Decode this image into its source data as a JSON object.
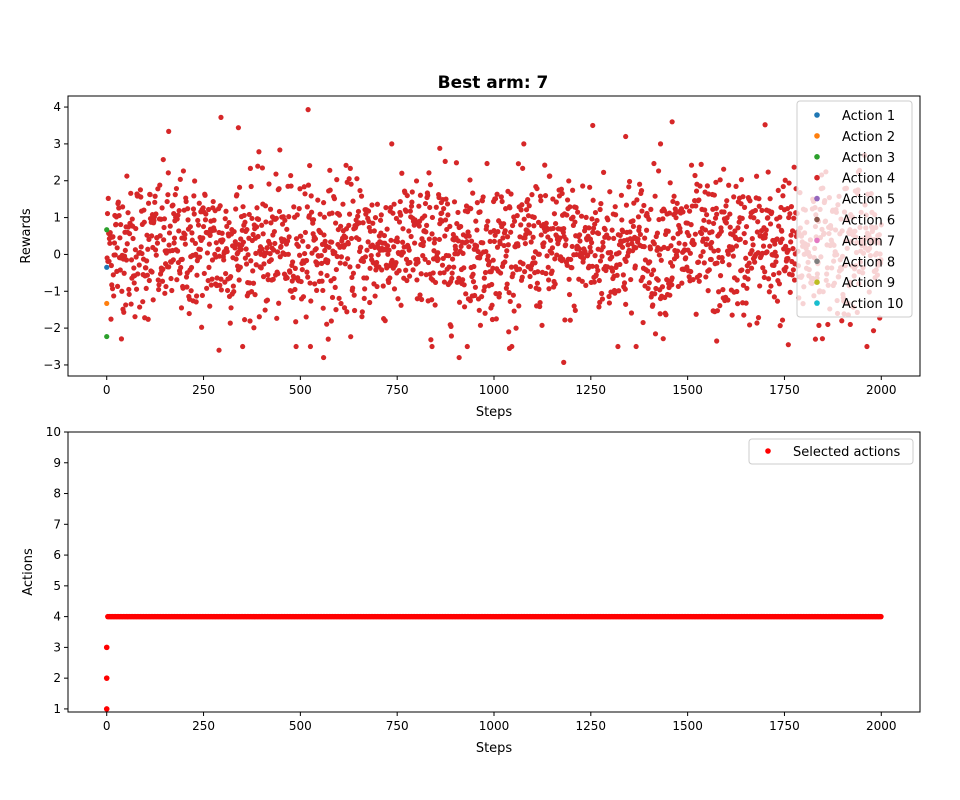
{
  "chart_data": [
    {
      "type": "scatter",
      "title": "Best arm: 7",
      "xlabel": "Steps",
      "ylabel": "Rewards",
      "xlim": [
        -100,
        2100
      ],
      "ylim": [
        -3.3,
        4.3
      ],
      "xticks": [
        0,
        250,
        500,
        750,
        1000,
        1250,
        1500,
        1750,
        2000
      ],
      "yticks": [
        -3,
        -2,
        -1,
        0,
        1,
        2,
        3,
        4
      ],
      "grid": false,
      "legend_position": "top-right",
      "n_steps": 2000,
      "series": [
        {
          "name": "Action 1",
          "color": "#1f77b4",
          "points": [
            [
              0,
              -0.35
            ]
          ]
        },
        {
          "name": "Action 2",
          "color": "#ff7f0e",
          "points": [
            [
              0,
              -1.33
            ]
          ]
        },
        {
          "name": "Action 3",
          "color": "#2ca02c",
          "points": [
            [
              0,
              0.67
            ],
            [
              0,
              -2.23
            ]
          ]
        },
        {
          "name": "Action 4",
          "color": "#d62728",
          "description": "noisy rewards every step 1..2000, mean ~0.2, std ~1.0, range about -2.9 to 3.9",
          "points": [
            [
              520,
              3.93
            ],
            [
              295,
              3.72
            ],
            [
              1460,
              3.6
            ],
            [
              1255,
              3.5
            ],
            [
              1700,
              3.52
            ],
            [
              340,
              3.44
            ],
            [
              160,
              3.34
            ],
            [
              1340,
              3.2
            ],
            [
              1430,
              3.0
            ],
            [
              860,
              2.88
            ],
            [
              1180,
              -2.93
            ],
            [
              910,
              -2.8
            ],
            [
              560,
              -2.8
            ],
            [
              290,
              -2.6
            ],
            [
              1920,
              -1.9
            ],
            [
              1575,
              -2.35
            ],
            [
              1830,
              -2.3
            ],
            [
              1040,
              -2.55
            ],
            [
              840,
              -2.5
            ],
            [
              1760,
              -2.45
            ]
          ]
        },
        {
          "name": "Action 5",
          "color": "#9467bd",
          "points": []
        },
        {
          "name": "Action 6",
          "color": "#8c564b",
          "points": []
        },
        {
          "name": "Action 7",
          "color": "#e377c2",
          "points": []
        },
        {
          "name": "Action 8",
          "color": "#7f7f7f",
          "points": []
        },
        {
          "name": "Action 9",
          "color": "#bcbd22",
          "points": []
        },
        {
          "name": "Action 10",
          "color": "#17becf",
          "points": []
        }
      ]
    },
    {
      "type": "scatter",
      "title": "",
      "xlabel": "Steps",
      "ylabel": "Actions",
      "xlim": [
        -100,
        2100
      ],
      "ylim": [
        0.9,
        10
      ],
      "xticks": [
        0,
        250,
        500,
        750,
        1000,
        1250,
        1500,
        1750,
        2000
      ],
      "yticks": [
        1,
        2,
        3,
        4,
        5,
        6,
        7,
        8,
        9,
        10
      ],
      "grid": false,
      "legend_position": "top-right",
      "series": [
        {
          "name": "Selected actions",
          "color": "#ff0000",
          "initial_points": [
            [
              0,
              1
            ],
            [
              0,
              2
            ],
            [
              0,
              3
            ]
          ],
          "constant_segment": {
            "x_start": 0,
            "x_end": 2000,
            "y": 4
          }
        }
      ]
    }
  ]
}
